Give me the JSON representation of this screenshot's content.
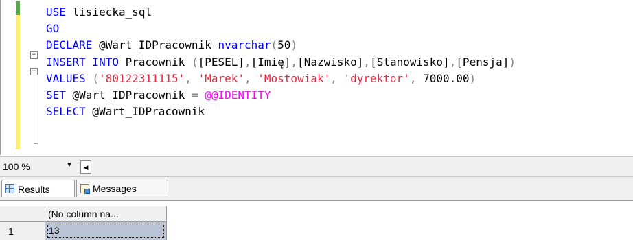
{
  "editor": {
    "lines": [
      [
        {
          "t": "USE",
          "c": "kw"
        },
        {
          "t": " lisiecka_sql",
          "c": ""
        }
      ],
      [
        {
          "t": "GO",
          "c": "kw"
        }
      ],
      [
        {
          "t": "DECLARE",
          "c": "kw"
        },
        {
          "t": " @Wart_IDPracownik ",
          "c": ""
        },
        {
          "t": "nvarchar",
          "c": "kw"
        },
        {
          "t": "(",
          "c": "gry"
        },
        {
          "t": "50",
          "c": ""
        },
        {
          "t": ")",
          "c": "gry"
        }
      ],
      [
        {
          "t": "INSERT INTO",
          "c": "kw"
        },
        {
          "t": " Pracownik ",
          "c": ""
        },
        {
          "t": "(",
          "c": "gry"
        },
        {
          "t": "[PESEL]",
          "c": ""
        },
        {
          "t": ",",
          "c": "gry"
        },
        {
          "t": "[Imię]",
          "c": ""
        },
        {
          "t": ",",
          "c": "gry"
        },
        {
          "t": "[Nazwisko]",
          "c": ""
        },
        {
          "t": ",",
          "c": "gry"
        },
        {
          "t": "[Stanowisko]",
          "c": ""
        },
        {
          "t": ",",
          "c": "gry"
        },
        {
          "t": "[Pensja]",
          "c": ""
        },
        {
          "t": ")",
          "c": "gry"
        }
      ],
      [
        {
          "t": "VALUES",
          "c": "kw"
        },
        {
          "t": " (",
          "c": "gry"
        },
        {
          "t": "'80122311115'",
          "c": "str"
        },
        {
          "t": ", ",
          "c": "gry"
        },
        {
          "t": "'Marek'",
          "c": "str"
        },
        {
          "t": ", ",
          "c": "gry"
        },
        {
          "t": "'Mostowiak'",
          "c": "str"
        },
        {
          "t": ", ",
          "c": "gry"
        },
        {
          "t": "'dyrektor'",
          "c": "str"
        },
        {
          "t": ", ",
          "c": "gry"
        },
        {
          "t": "7000.00",
          "c": ""
        },
        {
          "t": ")",
          "c": "gry"
        }
      ],
      [
        {
          "t": "SET",
          "c": "kw"
        },
        {
          "t": " @Wart_IDPracownik ",
          "c": ""
        },
        {
          "t": "=",
          "c": "gry"
        },
        {
          "t": " ",
          "c": ""
        },
        {
          "t": "@@IDENTITY",
          "c": "fn"
        }
      ],
      [
        {
          "t": "SELECT",
          "c": "kw"
        },
        {
          "t": " @Wart_IDPracownik",
          "c": ""
        }
      ]
    ]
  },
  "statusbar": {
    "zoom": "100 %"
  },
  "results": {
    "tabs": [
      {
        "label": "Results",
        "icon": "grid-icon"
      },
      {
        "label": "Messages",
        "icon": "messages-icon"
      }
    ],
    "column_header": "(No column na...",
    "rows": [
      {
        "num": "1",
        "value": "13"
      }
    ]
  },
  "colors": {
    "keyword": "#0000ff",
    "string": "#e8243d",
    "system_function": "#ff00ff",
    "operator": "#808080",
    "selected_cell": "#b9c4d6"
  }
}
